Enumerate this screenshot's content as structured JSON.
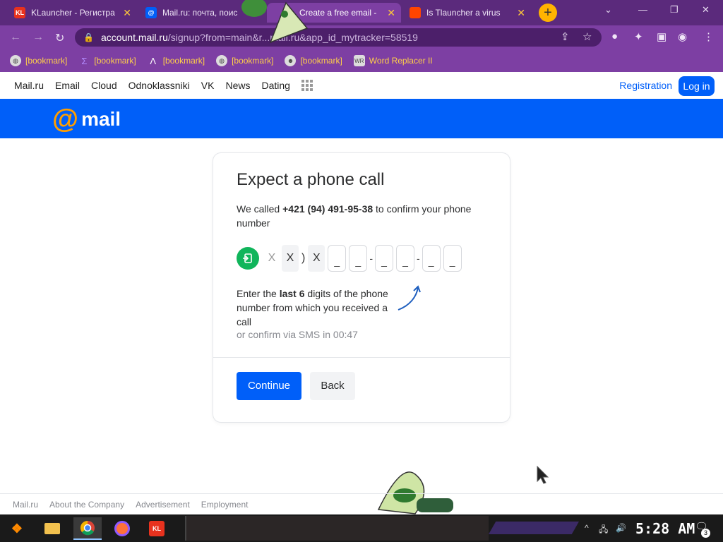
{
  "browser": {
    "tabs": [
      {
        "title": "KLauncher - Регистра",
        "favicon": "KL"
      },
      {
        "title": "Mail.ru: почта, поис",
        "favicon": "@"
      },
      {
        "title": "Create a free email -",
        "favicon": ""
      },
      {
        "title": "Is Tlauncher a virus",
        "favicon": ""
      }
    ],
    "active_tab": 2,
    "url_host": "account.mail.ru",
    "url_rest": "/signup?from=main&r...mail.ru&app_id_mytracker=58519",
    "bookmarks": [
      {
        "label": "[bookmark]",
        "icon": "globe-icon"
      },
      {
        "label": "[bookmark]",
        "icon": "bracket-icon"
      },
      {
        "label": "[bookmark]",
        "icon": "lambda-icon"
      },
      {
        "label": "[bookmark]",
        "icon": "globe-icon"
      },
      {
        "label": "[bookmark]",
        "icon": "ghost-icon"
      },
      {
        "label": "Word Replacer II",
        "icon": "wr-icon"
      }
    ]
  },
  "site_nav": {
    "links": [
      "Mail.ru",
      "Email",
      "Cloud",
      "Odnoklassniki",
      "VK",
      "News",
      "Dating"
    ],
    "registration": "Registration",
    "login": "Log in"
  },
  "brand": {
    "logo_text": "mail",
    "logo_at": "@"
  },
  "card": {
    "title": "Expect a phone call",
    "desc_before": "We called ",
    "desc_phone": "+421 (94) 491-95-38",
    "desc_after": " to confirm your phone number",
    "phone_prefix": [
      "X",
      "X",
      ")",
      "X"
    ],
    "digit_placeholder": "_",
    "hint_before": "Enter the ",
    "hint_bold": "last 6",
    "hint_after": " digits of the phone number from which you received a call",
    "sms_text": "or confirm via SMS in 00:47",
    "continue_label": "Continue",
    "back_label": "Back"
  },
  "footer": {
    "links": [
      "Mail.ru",
      "About the Company",
      "Advertisement",
      "Employment"
    ]
  },
  "taskbar": {
    "time": "5:28 AM",
    "notifications": "3"
  },
  "colors": {
    "accent": "#005ff9",
    "call_green": "#10b55b",
    "orange": "#ff9e00",
    "browser_purple": "#7d3fa3"
  }
}
